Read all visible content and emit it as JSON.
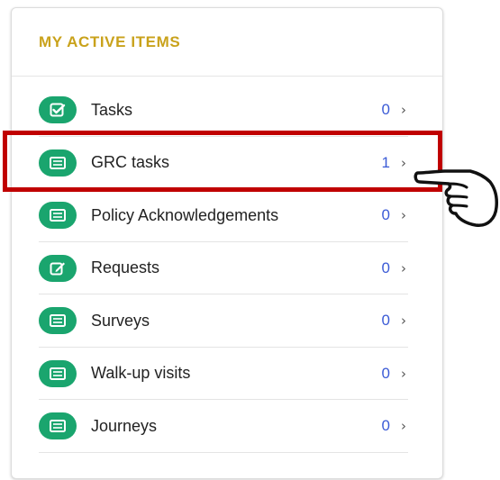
{
  "panel": {
    "title": "MY ACTIVE ITEMS",
    "items": [
      {
        "label": "Tasks",
        "count": "0",
        "chevron": "›",
        "icon": "check-square-icon"
      },
      {
        "label": "GRC tasks",
        "count": "1",
        "chevron": "›",
        "icon": "list-card-icon"
      },
      {
        "label": "Policy Acknowledgements",
        "count": "0",
        "chevron": "›",
        "icon": "list-card-icon"
      },
      {
        "label": "Requests",
        "count": "0",
        "chevron": "›",
        "icon": "edit-icon"
      },
      {
        "label": "Surveys",
        "count": "0",
        "chevron": "›",
        "icon": "list-card-icon"
      },
      {
        "label": "Walk-up visits",
        "count": "0",
        "chevron": "›",
        "icon": "list-card-icon"
      },
      {
        "label": "Journeys",
        "count": "0",
        "chevron": "›",
        "icon": "list-card-icon"
      }
    ]
  },
  "colors": {
    "title": "#c9a21b",
    "icon_bg": "#1aa56e",
    "count": "#3b5bd6",
    "highlight": "#c00000"
  },
  "annotation": {
    "highlighted_item": "GRC tasks",
    "pointer": "hand-cursor-icon"
  }
}
